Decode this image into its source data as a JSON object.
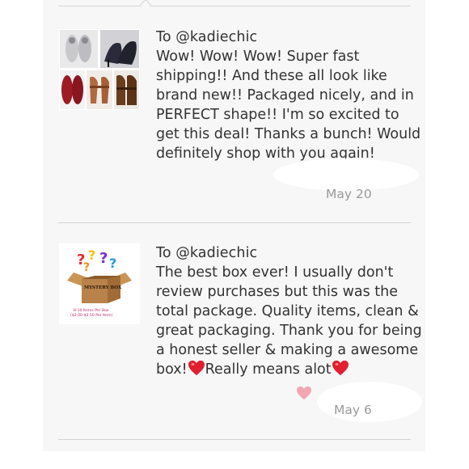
{
  "reviews": [
    {
      "to_label": "To @kadiechic",
      "message": "Wow! Wow! Wow! Super fast shipping!! And these all look like brand new!! Packaged nicely, and in PERFECT shape!! I'm so excited to get this deal! Thanks a bunch! Would definitely shop with you again!",
      "date": "May 20",
      "thumb": "shoes-photo-collage"
    },
    {
      "to_label": "To @kadiechic",
      "message_part1": "The best box ever! I usually don't review purchases but this was the total package. Quality items, clean & great packaging. Thank you for being a honest seller & making a awesome box!",
      "message_part2": "Really means alot",
      "date": "May 6",
      "thumb": "mystery-box-image",
      "thumb_box_label": "MYSTERY BOX",
      "thumb_caption_line1": "8-10 Items Per Box",
      "thumb_caption_line2": "($2.00-$2.50 Per Item)"
    }
  ],
  "colors": {
    "text": "#333333",
    "date": "#9a9a9a",
    "divider": "#d4d4d4",
    "panel": "#f7f7f7",
    "emoji_heart": "#e0202f",
    "like_heart": "#f2a7b3"
  }
}
